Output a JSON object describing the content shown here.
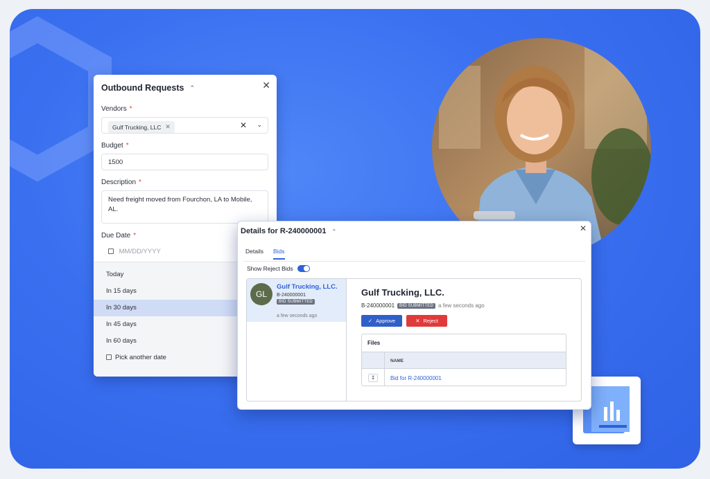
{
  "outbound": {
    "title": "Outbound Requests",
    "vendors_label": "Vendors",
    "vendor_chip": "Gulf Trucking, LLC",
    "budget_label": "Budget",
    "budget_value": "1500",
    "description_label": "Description",
    "description_value": "Need freight moved from Fourchon, LA to Mobile, AL.",
    "due_label": "Due Date",
    "due_placeholder": "MM/DD/YYYY",
    "required_mark": "*",
    "date_options": [
      "Today",
      "In 15 days",
      "In 30 days",
      "In 45 days",
      "In 60 days",
      "Pick another date"
    ],
    "selected_option": "In 30 days"
  },
  "details": {
    "title": "Details for R-240000001",
    "tabs": [
      "Details",
      "Bids"
    ],
    "active_tab": "Bids",
    "toggle_label": "Show Reject Bids",
    "toggle_on": true,
    "bid_card": {
      "initials": "GL",
      "name": "Gulf Trucking, LLC.",
      "id": "B-240000001",
      "badge": "BID SUBMITTED",
      "time": "a few seconds ago"
    },
    "detail": {
      "name": "Gulf Trucking, LLC.",
      "id": "B-240000001",
      "badge": "BID SUBMITTED",
      "time": "a few seconds ago",
      "approve_label": "Approve",
      "reject_label": "Reject"
    },
    "files": {
      "title": "Files",
      "column": "NAME",
      "rows": [
        "Bid for R-240000001"
      ]
    }
  },
  "colors": {
    "background": "#3a70f0",
    "accent": "#2e63d6",
    "approve": "#2f5fc9",
    "reject": "#e03b3b",
    "badge": "#6b7280"
  }
}
